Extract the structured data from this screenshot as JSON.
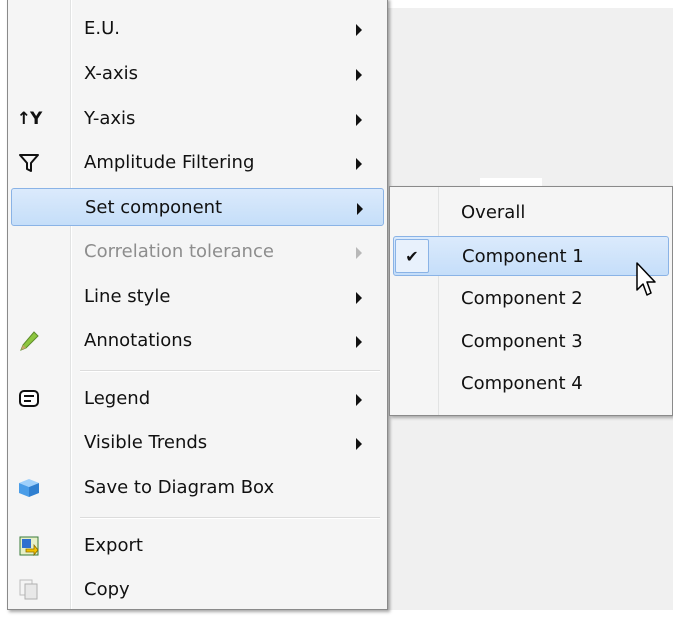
{
  "menu": {
    "items": [
      {
        "label": "E.U.",
        "icon": "",
        "has_submenu": true,
        "disabled": false
      },
      {
        "label": "X-axis",
        "icon": "",
        "has_submenu": true,
        "disabled": false
      },
      {
        "label": "Y-axis",
        "icon": "y-axis-icon",
        "has_submenu": true,
        "disabled": false
      },
      {
        "label": "Amplitude Filtering",
        "icon": "filter-icon",
        "has_submenu": true,
        "disabled": false
      },
      {
        "label": "Set component",
        "icon": "",
        "has_submenu": true,
        "disabled": false,
        "highlighted": true
      },
      {
        "label": "Correlation tolerance",
        "icon": "",
        "has_submenu": true,
        "disabled": true
      },
      {
        "label": "Line style",
        "icon": "",
        "has_submenu": true,
        "disabled": false
      },
      {
        "label": "Annotations",
        "icon": "pencil-icon",
        "has_submenu": true,
        "disabled": false
      },
      {
        "label": "Legend",
        "icon": "legend-icon",
        "has_submenu": true,
        "disabled": false
      },
      {
        "label": "Visible Trends",
        "icon": "",
        "has_submenu": true,
        "disabled": false
      },
      {
        "label": "Save to Diagram Box",
        "icon": "diagram-box-icon",
        "has_submenu": false,
        "disabled": false
      },
      {
        "label": "Export",
        "icon": "export-icon",
        "has_submenu": false,
        "disabled": false
      },
      {
        "label": "Copy",
        "icon": "copy-icon",
        "has_submenu": false,
        "disabled": false
      }
    ],
    "y_axis_icon_text": "↑Y"
  },
  "submenu": {
    "items": [
      {
        "label": "Overall",
        "checked": false
      },
      {
        "label": "Component 1",
        "checked": true,
        "highlighted": true
      },
      {
        "label": "Component 2",
        "checked": false
      },
      {
        "label": "Component 3",
        "checked": false
      },
      {
        "label": "Component 4",
        "checked": false
      }
    ],
    "check_glyph": "✔"
  },
  "colors": {
    "highlight_border": "#8ab3e6",
    "highlight_fill": "#c5def9",
    "disabled_text": "#8d8d8d"
  }
}
